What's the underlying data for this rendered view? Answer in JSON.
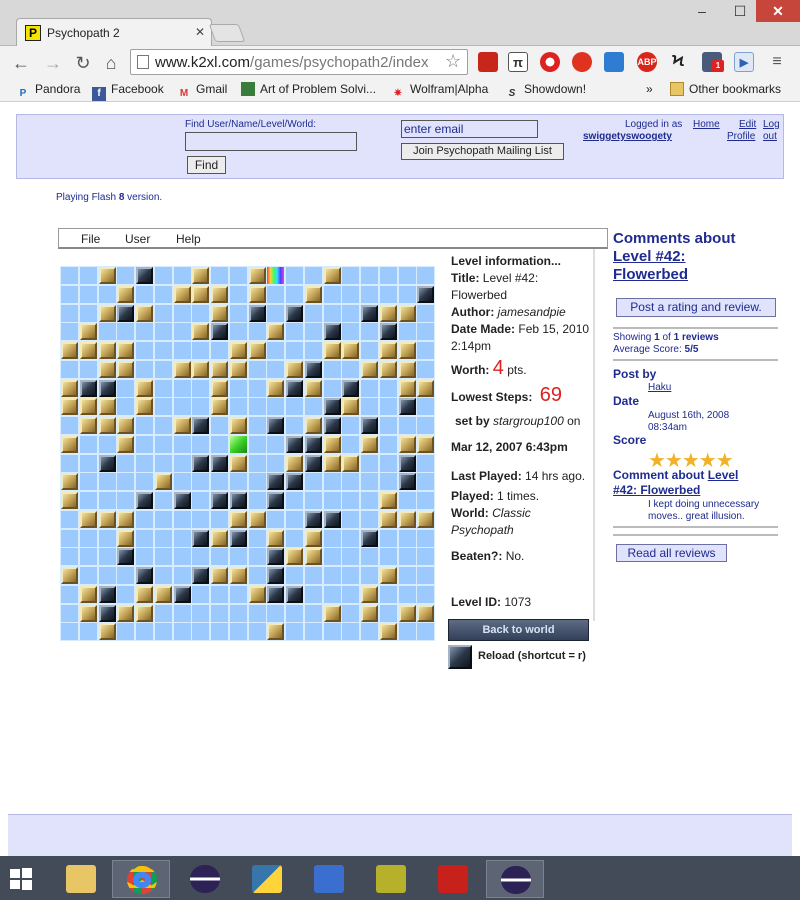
{
  "browser": {
    "tab_title": "Psychopath 2",
    "tab_favicon_letter": "P",
    "url_host": "www.k2xl.com",
    "url_path": "/games/psychopath2/index",
    "bookmarks": [
      "Pandora",
      "Facebook",
      "Gmail",
      "Art of Problem Solvi...",
      "Wolfram|Alpha",
      "Showdown!"
    ],
    "bookmarks_overflow": "»",
    "other_bookmarks": "Other bookmarks",
    "extensions": [
      "book-icon",
      "pi-icon",
      "pokeball-icon",
      "gear-burst-icon",
      "window-icon",
      "adblock-icon",
      "s-icon",
      "notifications-icon",
      "play-icon"
    ],
    "adblock_label": "ABP",
    "notification_count": "1"
  },
  "header": {
    "search_label": "Find User/Name/Level/World:",
    "search_value": "",
    "find_button": "Find",
    "email_placeholder": "enter email",
    "mailing_button": "Join Psychopath Mailing List",
    "logged_in_as": "Logged in as",
    "username": "swiggetyswoogety",
    "home": "Home",
    "edit": "Edit",
    "profile": "Profile",
    "log": "Log",
    "out": "out"
  },
  "flash_note": {
    "prefix": "Playing Flash ",
    "version": "8",
    "suffix": " version."
  },
  "game_menu": [
    "File",
    "User",
    "Help"
  ],
  "board": {
    "tile_colors": {
      "empty": "#9ccaff",
      "tan": "#c6a75a",
      "dark": "#2c3849",
      "player": "#3bd02a"
    },
    "rows": [
      "..T.D..T..TR..T.....",
      "...T..TTT.T..T.....D",
      "..TDT...T.D.D...DTT.",
      ".T.....TD..T..D..D..",
      "TTTT.....TT...TT.TT.",
      "..TT..TTTT..TD..TTT.",
      "TDD.T...T..TDT.D..TT",
      "TTT.T...T.....DT..D.",
      ".TTT..TD.T.D.TD.D...",
      "T..T.....G..DDT.T.TT",
      "..D....DDT..TDTT..D.",
      "T....T.....DD.....D.",
      "T...D.D.DD.D.....T..",
      ".TTT.....TT..DD..TTT",
      "...T...DTD.T.T..D...",
      "...D.......DTT......",
      "T...D..DTT.D.....T..",
      ".TD.TTD...TDD...T...",
      ".TDTT.........T.T.TT",
      "..T........T.....T.."
    ]
  },
  "level_info": {
    "heading": "Level information...",
    "title_label": "Title:",
    "title_value": "Level #42:",
    "title_value2": "Flowerbed",
    "author_label": "Author:",
    "author_value": "jamesandpie",
    "date_label": "Date Made:",
    "date_value": "Feb 15, 2010",
    "date_time": "2:14pm",
    "worth_label": "Worth:",
    "worth_value": "4",
    "worth_unit": "pts.",
    "lowest_label": "Lowest Steps:",
    "lowest_value": "69",
    "set_by_label": "set by",
    "set_by_value": "stargroup100",
    "set_by_on": "on",
    "set_date": "Mar 12, 2007 6:43pm",
    "last_played_label": "Last Played:",
    "last_played_value": "14 hrs ago.",
    "played_label": "Played:",
    "played_value": "1 times.",
    "world_label": "World:",
    "world_value": "Classic",
    "world_value2": "Psychopath",
    "beaten_label": "Beaten?:",
    "beaten_value": "No.",
    "id_label": "Level ID:",
    "id_value": "1073",
    "back_button": "Back to world",
    "reload_label": "Reload (shortcut = r)"
  },
  "comments": {
    "title_prefix": "Comments about",
    "title_link": "Level #42:",
    "title_link2": "Flowerbed",
    "post_button": "Post a rating and review.",
    "showing_label": "Showing",
    "showing_from": "1",
    "showing_of": "of",
    "showing_total": "1 reviews",
    "avg_label": "Average Score:",
    "avg_value": "5/5",
    "post_by_label": "Post by",
    "post_by_value": "Haku",
    "date_label": "Date",
    "date_value": "August 16th, 2008",
    "date_time": "08:34am",
    "score_label": "Score",
    "score_stars": 5,
    "stars_glyph": "★★★★★",
    "comment_label": "Comment about",
    "comment_link": "Level",
    "comment_link2": "#42: Flowerbed",
    "comment_text1": "I kept doing unnecessary",
    "comment_text2": "moves.. great illusion.",
    "read_all_button": "Read all reviews"
  },
  "taskbar": [
    "start-icon",
    "file-explorer-icon",
    "chrome-icon",
    "eclipse-icon",
    "python-icon",
    "network-icon",
    "texmaker-icon",
    "acrobat-icon",
    "eclipse-icon"
  ]
}
